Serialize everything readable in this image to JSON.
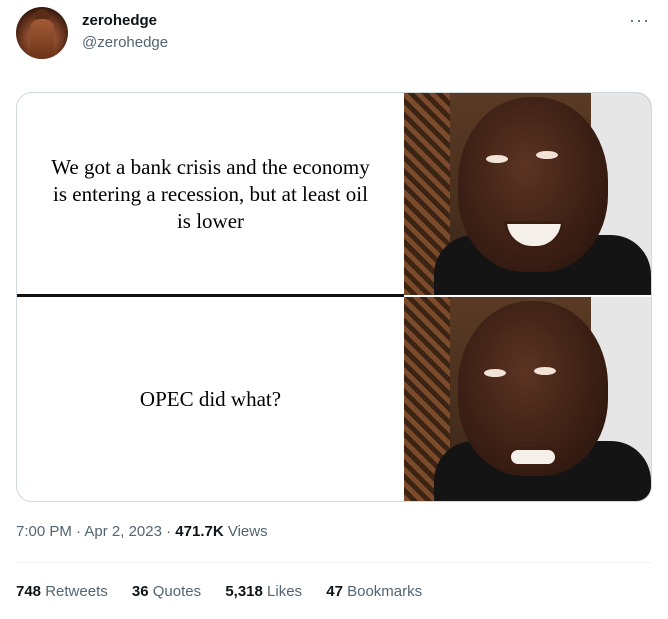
{
  "tweet": {
    "author": {
      "name": "zerohedge",
      "handle": "@zerohedge"
    },
    "more_icon": "more-horizontal-icon",
    "media": {
      "top_text": "We got a bank crisis and the economy is entering a recession, but at least oil is lower",
      "bottom_text": "OPEC did what?"
    },
    "time": "7:00 PM",
    "date": "Apr 2, 2023",
    "views_count": "471.7K",
    "views_label": "Views",
    "stats": {
      "retweets_count": "748",
      "retweets_label": "Retweets",
      "quotes_count": "36",
      "quotes_label": "Quotes",
      "likes_count": "5,318",
      "likes_label": "Likes",
      "bookmarks_count": "47",
      "bookmarks_label": "Bookmarks"
    }
  }
}
